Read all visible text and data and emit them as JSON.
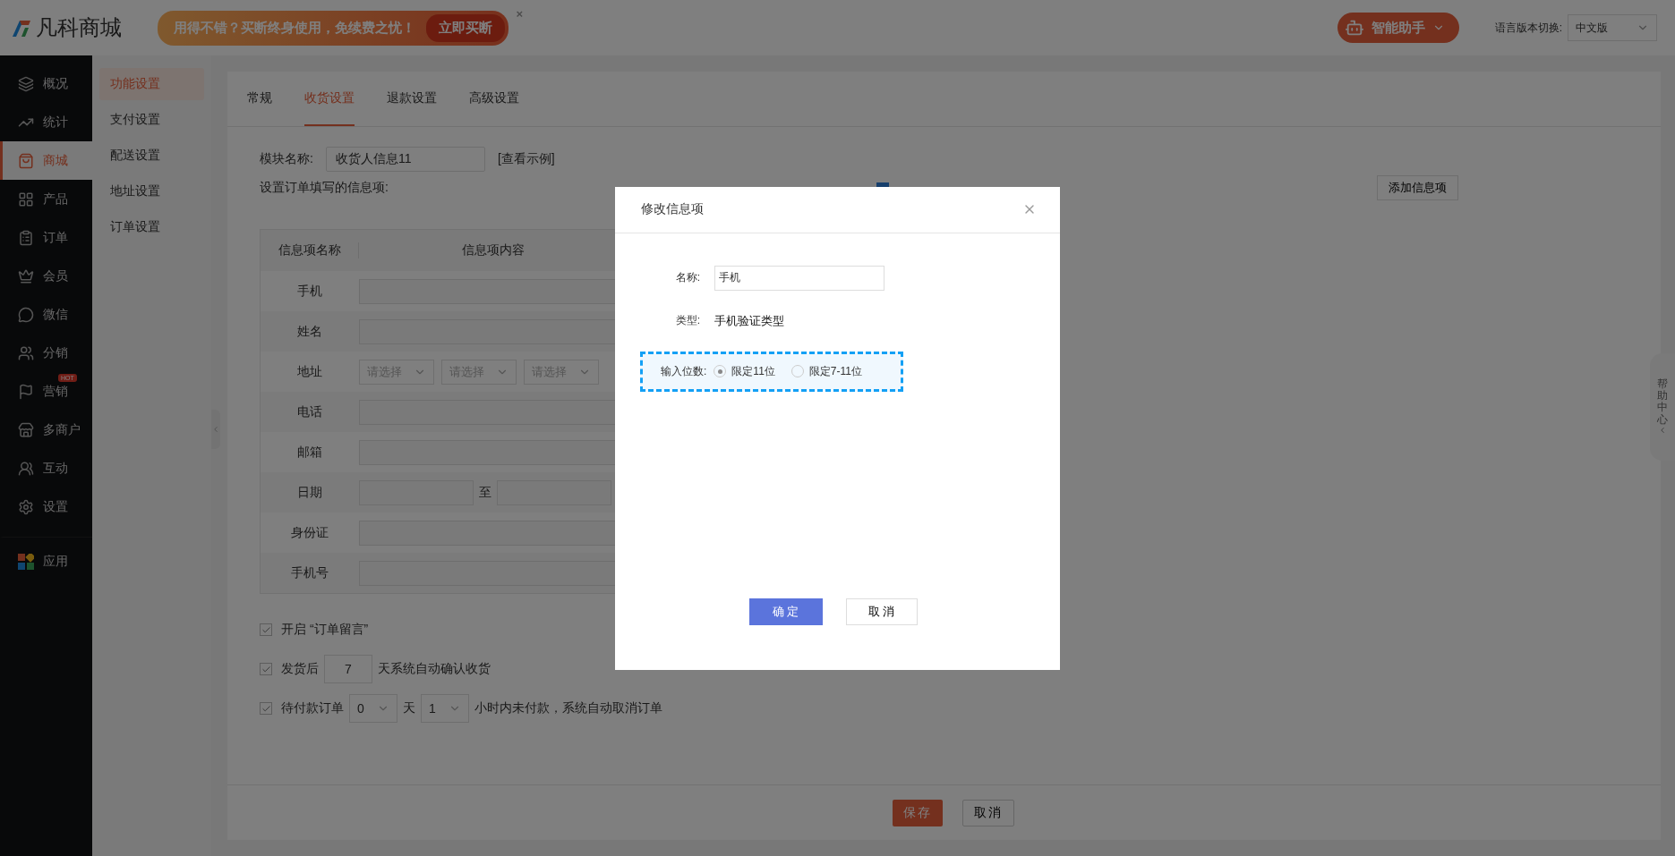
{
  "top_bar": {
    "logo": "凡科商城",
    "promo": {
      "text": "用得不错？买断终身使用，免续费之忧！",
      "button": "立即买断",
      "close": "×"
    },
    "assistant": "智能助手",
    "language": {
      "label": "语言版本切换:",
      "value": "中文版"
    }
  },
  "sidebar": {
    "items": [
      {
        "label": "概况",
        "selected": false
      },
      {
        "label": "统计",
        "selected": false
      },
      {
        "label": "商城",
        "selected": true
      },
      {
        "label": "产品",
        "selected": false
      },
      {
        "label": "订单",
        "selected": false
      },
      {
        "label": "会员",
        "selected": false
      },
      {
        "label": "微信",
        "selected": false
      },
      {
        "label": "分销",
        "selected": false
      },
      {
        "label": "营销",
        "selected": false,
        "badge": "HOT"
      },
      {
        "label": "多商户",
        "selected": false
      },
      {
        "label": "互动",
        "selected": false
      },
      {
        "label": "设置",
        "selected": false
      },
      {
        "label": "应用",
        "selected": false
      }
    ]
  },
  "submenu": {
    "items": [
      {
        "label": "功能设置",
        "selected": true
      },
      {
        "label": "支付设置",
        "selected": false
      },
      {
        "label": "配送设置",
        "selected": false
      },
      {
        "label": "地址设置",
        "selected": false
      },
      {
        "label": "订单设置",
        "selected": false
      }
    ]
  },
  "tabs": [
    {
      "label": "常规",
      "selected": false
    },
    {
      "label": "收货设置",
      "selected": true
    },
    {
      "label": "退款设置",
      "selected": false
    },
    {
      "label": "高级设置",
      "selected": false
    }
  ],
  "form": {
    "module_label": "模块名称:",
    "module_value": "收货人信息11",
    "example_link": "[查看示例]",
    "items_label": "设置订单填写的信息项:",
    "add_button": "添加信息项"
  },
  "table": {
    "columns": [
      "信息项名称",
      "信息项内容"
    ],
    "rows": [
      {
        "name": "手机",
        "kind": "input"
      },
      {
        "name": "姓名",
        "kind": "input"
      },
      {
        "name": "地址",
        "kind": "selects",
        "placeholders": [
          "请选择",
          "请选择",
          "请选择"
        ]
      },
      {
        "name": "电话",
        "kind": "input"
      },
      {
        "name": "邮箱",
        "kind": "input"
      },
      {
        "name": "日期",
        "kind": "range",
        "separator": "至"
      },
      {
        "name": "身份证",
        "kind": "input"
      },
      {
        "name": "手机号",
        "kind": "input"
      }
    ]
  },
  "options": [
    {
      "kind": "plain",
      "checked": true,
      "label": "开启 “订单留言”"
    },
    {
      "kind": "days",
      "checked": true,
      "before": "发货后",
      "value": "7",
      "after": "天系统自动确认收货"
    },
    {
      "kind": "timeout",
      "checked": true,
      "before": "待付款订单",
      "days": "0",
      "days_unit": "天",
      "hours": "1",
      "after": "小时内未付款，系统自动取消订单"
    }
  ],
  "footer": {
    "save": "保存",
    "cancel": "取消"
  },
  "help_tab": "帮助中心",
  "modal": {
    "title": "修改信息项",
    "name_label": "名称:",
    "name_value": "手机",
    "type_label": "类型:",
    "type_value": "手机验证类型",
    "digits_label": "输入位数:",
    "digits_options": [
      {
        "label": "限定11位",
        "selected": true
      },
      {
        "label": "限定7-11位",
        "selected": false
      }
    ],
    "ok": "确 定",
    "cancel": "取 消"
  }
}
